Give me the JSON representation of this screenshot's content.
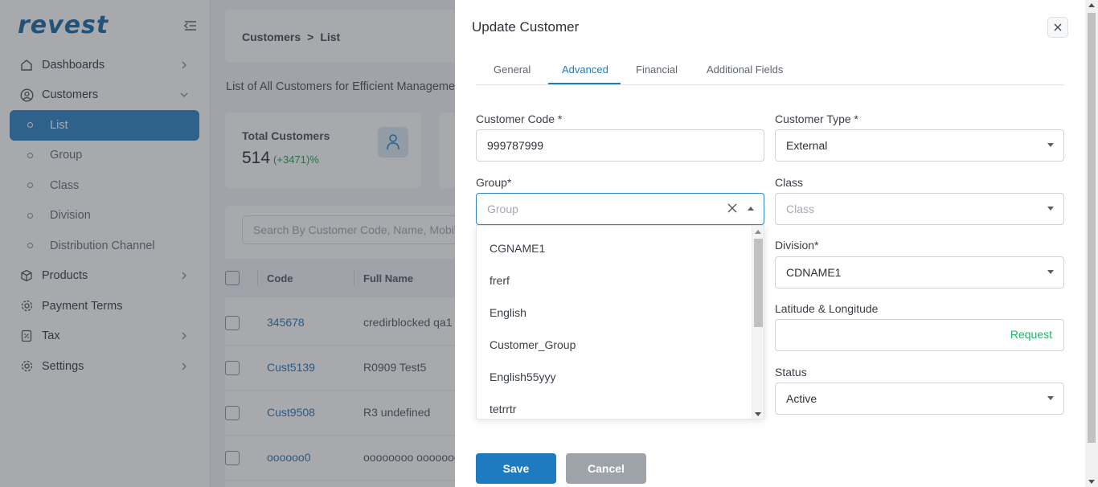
{
  "app": {
    "logo": "revest"
  },
  "sidebar": {
    "items": [
      {
        "label": "Dashboards",
        "icon": "home-icon"
      },
      {
        "label": "Customers",
        "icon": "user-circle-icon"
      },
      {
        "label": "List"
      },
      {
        "label": "Group"
      },
      {
        "label": "Class"
      },
      {
        "label": "Division"
      },
      {
        "label": "Distribution Channel"
      },
      {
        "label": "Products",
        "icon": "box-icon"
      },
      {
        "label": "Payment Terms",
        "icon": "gear-icon"
      },
      {
        "label": "Tax",
        "icon": "receipt-icon"
      },
      {
        "label": "Settings",
        "icon": "gear-icon"
      }
    ]
  },
  "page": {
    "breadcrumb": [
      "Customers",
      "List"
    ],
    "subtitle": "List of All Customers for Efficient Management",
    "stats": {
      "label": "Total Customers",
      "value": "514",
      "delta": "(+3471)%"
    },
    "search_placeholder": "Search By Customer Code, Name, Mobile",
    "table": {
      "headers": [
        "Code",
        "Full Name"
      ],
      "rows": [
        {
          "code": "345678",
          "name": "credirblocked qa1"
        },
        {
          "code": "Cust5139",
          "name": "R0909 Test5"
        },
        {
          "code": "Cust9508",
          "name": "R3 undefined"
        },
        {
          "code": "oooooo0",
          "name": "oooooooo ooooooo"
        }
      ]
    }
  },
  "drawer": {
    "title": "Update Customer",
    "tabs": [
      "General",
      "Advanced",
      "Financial",
      "Additional Fields"
    ],
    "active_tab": "Advanced",
    "fields": {
      "customer_code": {
        "label": "Customer Code *",
        "value": "999787999"
      },
      "customer_type": {
        "label": "Customer Type *",
        "value": "External"
      },
      "group": {
        "label": "Group*",
        "placeholder": "Group"
      },
      "class": {
        "label": "Class",
        "placeholder": "Class"
      },
      "division": {
        "label": "Division*",
        "value": "CDNAME1"
      },
      "latlng": {
        "label": "Latitude & Longitude",
        "action": "Request"
      },
      "status": {
        "label": "Status",
        "value": "Active"
      }
    },
    "group_options": [
      "CGNAME1",
      "frerf",
      "English",
      "Customer_Group",
      "English55yyy",
      "tetrrtr"
    ],
    "buttons": {
      "save": "Save",
      "cancel": "Cancel"
    }
  },
  "colors": {
    "accent": "#1e7bc0",
    "request": "#1fb56b"
  }
}
